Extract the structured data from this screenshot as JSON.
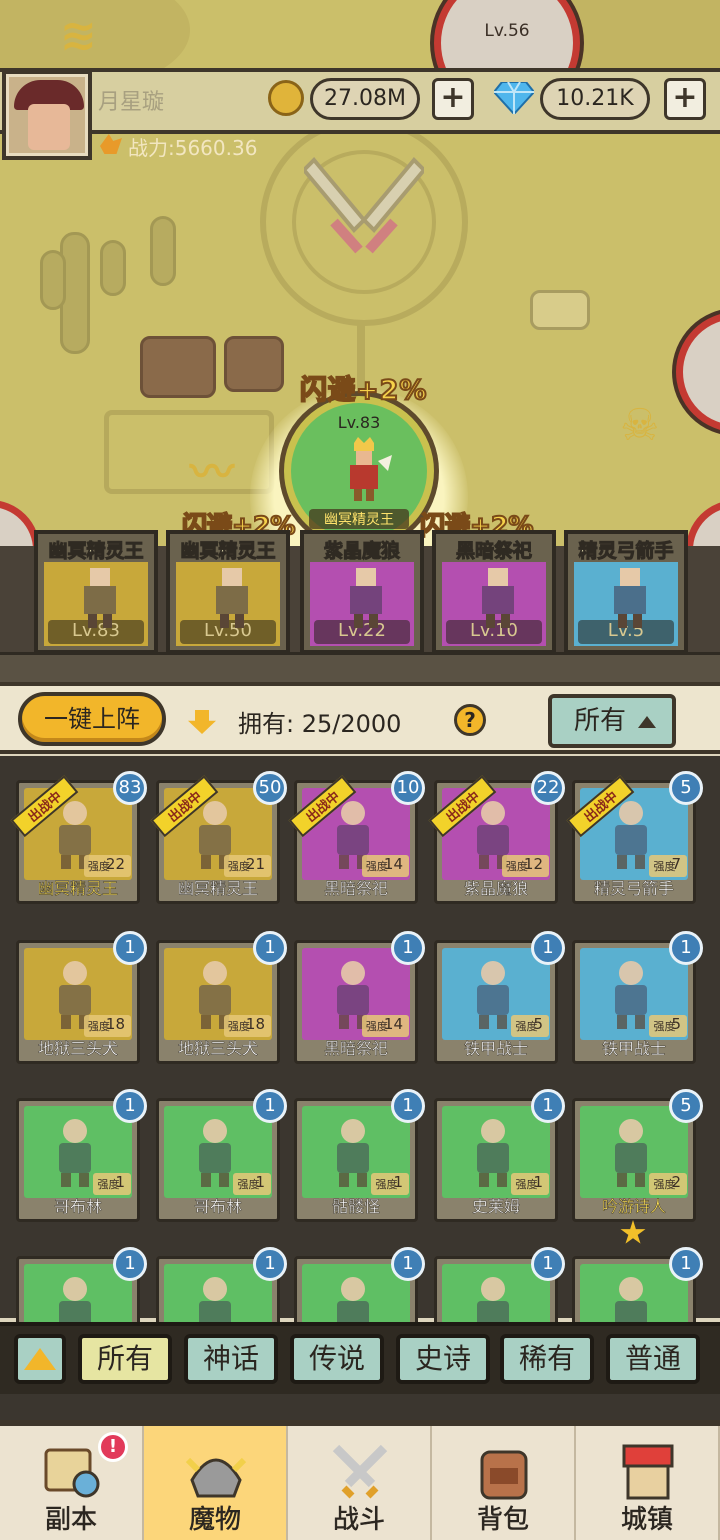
{
  "map": {
    "boss_top_level": "Lv.56",
    "center_node": {
      "level": "Lv.83",
      "name": "幽冥精灵王"
    },
    "buff_main": "闪避+2%",
    "buff_left": "闪避+2%",
    "buff_right": "闪避+2%"
  },
  "player": {
    "name": "月星璇",
    "gold": "27.08M",
    "gems": "10.21K",
    "power": "战力:5660.36",
    "add_label": "+"
  },
  "team": [
    {
      "name": "幽冥精灵王",
      "level": "Lv.83",
      "color": "#c8a83a"
    },
    {
      "name": "幽冥精灵王",
      "level": "Lv.50",
      "color": "#c8a83a"
    },
    {
      "name": "紫晶魔狼",
      "level": "Lv.22",
      "color": "#b44fb0"
    },
    {
      "name": "黑暗祭祀",
      "level": "Lv.10",
      "color": "#b44fb0"
    },
    {
      "name": "精灵弓箭手",
      "level": "Lv.5",
      "color": "#5ab0d0"
    }
  ],
  "collection": {
    "deploy_label": "一键上阵",
    "owned_text": "拥有: 25/2000",
    "help_label": "?",
    "sort_label": "所有",
    "deployed_tag": "出战中",
    "strength_key": "强度",
    "rows": [
      [
        {
          "name": "幽冥精灵王",
          "strength": "22",
          "count": "83",
          "deployed": true,
          "color": "#c8a83a",
          "gold": true
        },
        {
          "name": "幽冥精灵王",
          "strength": "21",
          "count": "50",
          "deployed": true,
          "color": "#c8a83a",
          "gold": false
        },
        {
          "name": "黑暗祭祀",
          "strength": "14",
          "count": "10",
          "deployed": true,
          "color": "#b44fb0",
          "gold": false
        },
        {
          "name": "紫晶魔狼",
          "strength": "12",
          "count": "22",
          "deployed": true,
          "color": "#b44fb0",
          "gold": false
        },
        {
          "name": "精灵弓箭手",
          "strength": "7",
          "count": "5",
          "deployed": true,
          "color": "#5ab0d0",
          "gold": false
        }
      ],
      [
        {
          "name": "地狱三头犬",
          "strength": "18",
          "count": "1",
          "deployed": false,
          "color": "#c8a83a",
          "gold": false
        },
        {
          "name": "地狱三头犬",
          "strength": "18",
          "count": "1",
          "deployed": false,
          "color": "#c8a83a",
          "gold": false
        },
        {
          "name": "黑暗祭祀",
          "strength": "14",
          "count": "1",
          "deployed": false,
          "color": "#b44fb0",
          "gold": false
        },
        {
          "name": "铁甲战士",
          "strength": "5",
          "count": "1",
          "deployed": false,
          "color": "#5ab0d0",
          "gold": false
        },
        {
          "name": "铁甲战士",
          "strength": "5",
          "count": "1",
          "deployed": false,
          "color": "#5ab0d0",
          "gold": false
        }
      ],
      [
        {
          "name": "哥布林",
          "strength": "1",
          "count": "1",
          "deployed": false,
          "color": "#5fbf64",
          "gold": false
        },
        {
          "name": "哥布林",
          "strength": "1",
          "count": "1",
          "deployed": false,
          "color": "#5fbf64",
          "gold": false
        },
        {
          "name": "骷髅怪",
          "strength": "1",
          "count": "1",
          "deployed": false,
          "color": "#5fbf64",
          "gold": false
        },
        {
          "name": "史莱姆",
          "strength": "1",
          "count": "1",
          "deployed": false,
          "color": "#5fbf64",
          "gold": false
        },
        {
          "name": "吟游诗人",
          "strength": "2",
          "count": "5",
          "deployed": false,
          "color": "#5fbf64",
          "gold": true
        }
      ],
      [
        {
          "name": "",
          "strength": "",
          "count": "1",
          "deployed": false,
          "color": "#5fbf64",
          "gold": false
        },
        {
          "name": "",
          "strength": "",
          "count": "1",
          "deployed": false,
          "color": "#5fbf64",
          "gold": false
        },
        {
          "name": "",
          "strength": "",
          "count": "1",
          "deployed": false,
          "color": "#5fbf64",
          "gold": false
        },
        {
          "name": "",
          "strength": "",
          "count": "1",
          "deployed": false,
          "color": "#5fbf64",
          "gold": false
        },
        {
          "name": "",
          "strength": "",
          "count": "1",
          "deployed": false,
          "color": "#5fbf64",
          "gold": false
        }
      ]
    ]
  },
  "rarity_filters": [
    "所有",
    "神话",
    "传说",
    "史诗",
    "稀有",
    "普通"
  ],
  "nav": {
    "tabs": [
      {
        "label": "副本",
        "icon": "map-scroll-icon"
      },
      {
        "label": "魔物",
        "icon": "monster-helmet-icon"
      },
      {
        "label": "战斗",
        "icon": "crossed-swords-icon"
      },
      {
        "label": "背包",
        "icon": "backpack-icon"
      },
      {
        "label": "城镇",
        "icon": "town-shop-icon"
      }
    ],
    "badge": "!"
  },
  "colors": {
    "accent": "#f2b62a",
    "panel": "#ddd5bd",
    "filter_active": "#e6e5a2",
    "filter": "#a9d0c4",
    "level_badge": "#3f7fb5"
  }
}
